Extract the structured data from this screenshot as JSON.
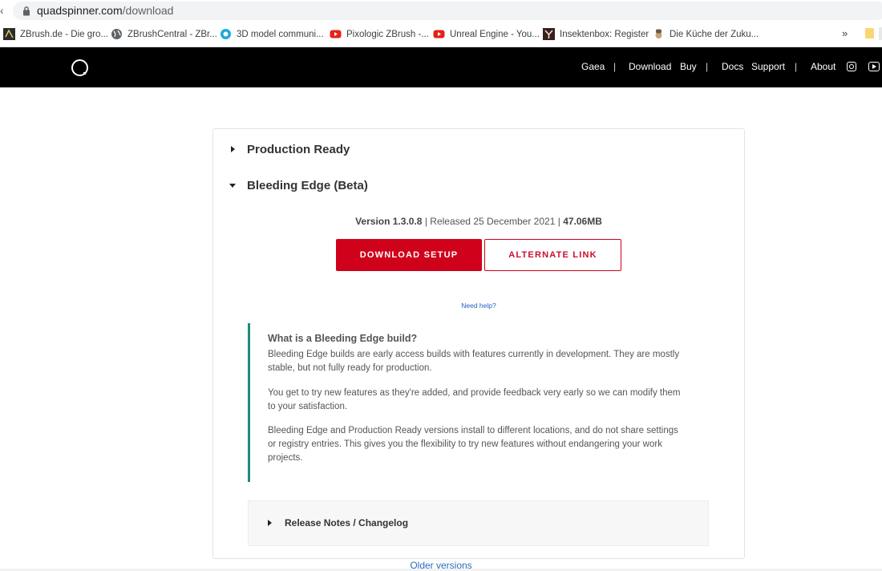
{
  "browser": {
    "url_domain": "quadspinner.com",
    "url_path": "/download",
    "bookmarks": [
      {
        "label": "ZBrush.de - Die gro...",
        "icon": "zbrush-icon"
      },
      {
        "label": "ZBrushCentral - ZBr...",
        "icon": "globe-icon"
      },
      {
        "label": "3D model communi...",
        "icon": "sketchfab-icon"
      },
      {
        "label": "Pixologic ZBrush -...",
        "icon": "youtube-icon"
      },
      {
        "label": "Unreal Engine - You...",
        "icon": "youtube-icon"
      },
      {
        "label": "Insektenbox: Register",
        "icon": "insect-icon"
      },
      {
        "label": "Die Küche der Zuku...",
        "icon": "chef-icon"
      }
    ],
    "more_label": "»"
  },
  "nav": {
    "items": [
      "Gaea",
      "Download",
      "Buy",
      "Docs",
      "Support",
      "About"
    ],
    "separator": "|"
  },
  "sections": {
    "production": "Production Ready",
    "bleeding": "Bleeding Edge (Beta)"
  },
  "release": {
    "version": "Version 1.3.0.8",
    "released": "Released 25 December 2021",
    "size": "47.06MB",
    "sep": "|"
  },
  "buttons": {
    "download": "DOWNLOAD SETUP",
    "alternate": "ALTERNATE LINK"
  },
  "help_link": "Need help?",
  "callout": {
    "title": "What is a Bleeding Edge build?",
    "p1": "Bleeding Edge builds are early access builds with features currently in development. They are mostly stable, but not fully ready for production.",
    "p2": "You get to try new features as they're added, and provide feedback very early so we can modify them to your satisfaction.",
    "p3": "Bleeding Edge and Production Ready versions install to different locations, and do not share settings or registry entries. This gives you the flexibility to try new features without endangering your work projects."
  },
  "release_notes": "Release Notes / Changelog",
  "older_versions": "Older versions",
  "colors": {
    "accent_red": "#d0021b",
    "callout_border": "#1f8a80",
    "link_blue": "#1f5fbf"
  }
}
